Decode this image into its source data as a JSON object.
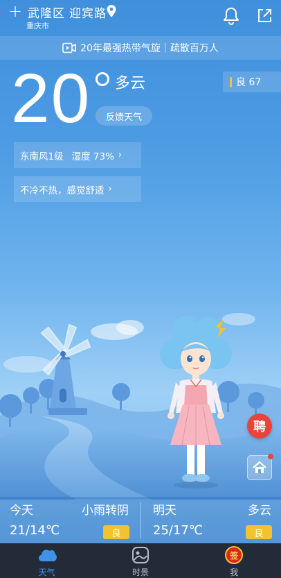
{
  "header": {
    "district": "武隆区",
    "street": "迎宾路",
    "city": "重庆市",
    "add_icon": "plus-icon",
    "location_icon": "location-pin-icon",
    "bell_icon": "bell-icon",
    "share_icon": "share-icon"
  },
  "banner": {
    "icon": "video-icon",
    "text": "20年最强热带气旋｜疏散百万人"
  },
  "current": {
    "temperature": "20",
    "condition": "多云",
    "feedback_label": "反馈天气",
    "aqi_label": "良 67",
    "aqi_color": "#f2c230"
  },
  "details": {
    "wind": "东南风1级",
    "humidity": "湿度 73%",
    "comfort": "不冷不热，感觉舒适",
    "chevron": "›"
  },
  "floating": {
    "hire_label": "聘",
    "home_icon": "home-icon"
  },
  "forecast": {
    "today": {
      "day": "今天",
      "condition": "小雨转阴",
      "temp": "21/14℃",
      "aqi": "良"
    },
    "tomorrow": {
      "day": "明天",
      "condition": "多云",
      "temp": "25/17℃",
      "aqi": "良"
    }
  },
  "nav": {
    "items": [
      {
        "label": "天气",
        "icon": "cloud-icon",
        "active": true
      },
      {
        "label": "时景",
        "icon": "photo-icon",
        "active": false
      },
      {
        "label": "我",
        "icon": "checkin-icon",
        "badge": "签",
        "active": false
      }
    ],
    "active_color": "#3e93e8"
  }
}
